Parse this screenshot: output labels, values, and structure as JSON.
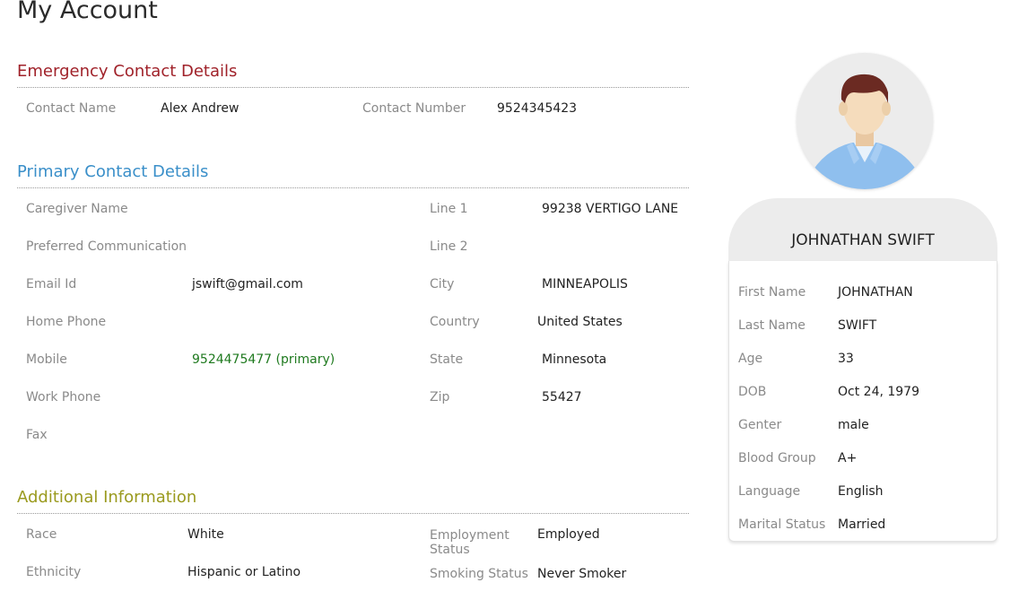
{
  "page": {
    "title": "My Account"
  },
  "colors": {
    "emergency": "#a0222a",
    "primary": "#3a8fc9",
    "additional": "#9a9a1e",
    "mobile": "#1f7a1f"
  },
  "emergency": {
    "title": "Emergency Contact Details",
    "contact_name_label": "Contact Name",
    "contact_name": "Alex Andrew",
    "contact_number_label": "Contact Number",
    "contact_number": "9524345423"
  },
  "primary": {
    "title": "Primary Contact Details",
    "left": [
      {
        "label": "Caregiver Name",
        "value": ""
      },
      {
        "label": "Preferred Communication",
        "value": ""
      },
      {
        "label": "Email Id",
        "value": "jswift@gmail.com"
      },
      {
        "label": "Home Phone",
        "value": ""
      },
      {
        "label": "Mobile",
        "value": "9524475477 (primary)"
      },
      {
        "label": "Work Phone",
        "value": ""
      },
      {
        "label": "Fax",
        "value": ""
      }
    ],
    "right": [
      {
        "label": "Line 1",
        "value": "99238 VERTIGO LANE"
      },
      {
        "label": "Line 2",
        "value": ""
      },
      {
        "label": "City",
        "value": "MINNEAPOLIS"
      },
      {
        "label": "Country",
        "value": "United States"
      },
      {
        "label": "State",
        "value": "Minnesota"
      },
      {
        "label": "Zip",
        "value": "55427"
      }
    ]
  },
  "additional": {
    "title": "Additional Information",
    "left": [
      {
        "label": "Race",
        "value": "White"
      },
      {
        "label": "Ethnicity",
        "value": "Hispanic or Latino"
      }
    ],
    "right": [
      {
        "label": "Employment Status",
        "value": "Employed"
      },
      {
        "label": "Smoking Status",
        "value": "Never Smoker"
      }
    ]
  },
  "profile": {
    "avatar_icon": "user-avatar-icon",
    "name": "JOHNATHAN SWIFT",
    "fields": [
      {
        "label": "First Name",
        "value": "JOHNATHAN"
      },
      {
        "label": "Last Name",
        "value": "SWIFT"
      },
      {
        "label": "Age",
        "value": "33"
      },
      {
        "label": "DOB",
        "value": "Oct 24, 1979"
      },
      {
        "label": "Genter",
        "value": "male"
      },
      {
        "label": "Blood Group",
        "value": "A+"
      },
      {
        "label": "Language",
        "value": "English"
      },
      {
        "label": "Marital Status",
        "value": "Married"
      }
    ]
  }
}
